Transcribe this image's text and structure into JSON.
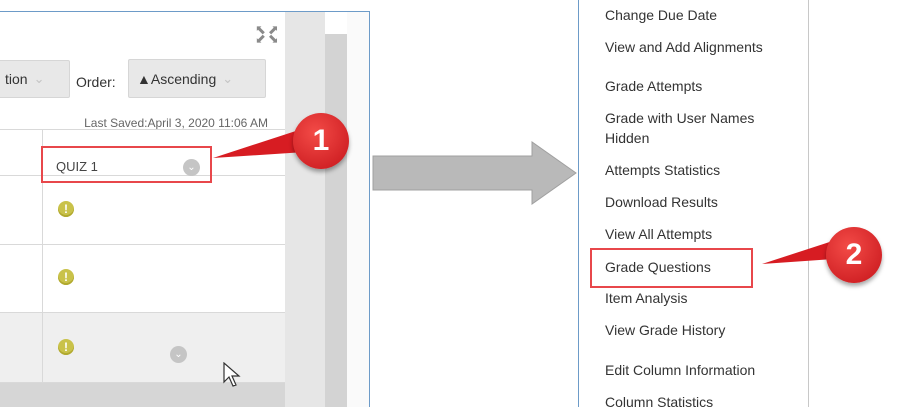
{
  "grid_toolbar": {
    "option_label_partial": "tion",
    "order_label": "Order:",
    "ascending_label": "▲Ascending",
    "last_saved": "Last Saved:April 3, 2020 11:06 AM"
  },
  "column_header": {
    "label": "QUIZ 1"
  },
  "rows": [
    {
      "status": "!"
    },
    {
      "status": "!"
    },
    {
      "status": "!"
    }
  ],
  "callouts": {
    "step1": "1",
    "step2": "2"
  },
  "menu": {
    "items": [
      "Change Due Date",
      "View and Add Alignments",
      "Grade Attempts",
      "Grade with User Names",
      "Hidden",
      "Attempts Statistics",
      "Download Results",
      "View All Attempts",
      "Grade Questions",
      "Item Analysis",
      "View Grade History",
      "Edit Column Information",
      "Column Statistics"
    ]
  },
  "colors": {
    "highlight": "#e8474b",
    "callout": "#d71c22",
    "panel_border": "#6d9bc8"
  }
}
